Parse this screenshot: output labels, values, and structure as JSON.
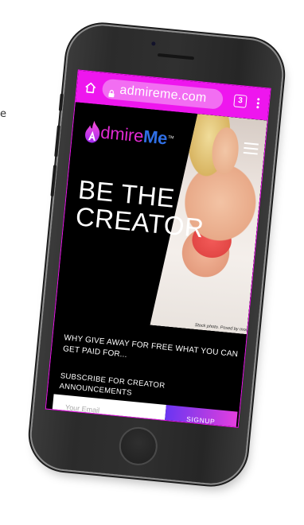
{
  "edge_fragment": "e",
  "browser": {
    "url": "admireme.com",
    "tab_count": "3"
  },
  "brand": {
    "name_part1": "dmire",
    "name_part2": "Me",
    "trademark": "TM",
    "primary_color": "#ee16ee",
    "pink": "#e02ad2",
    "blue": "#2f6fe6"
  },
  "hero": {
    "headline_line1": "BE THE",
    "headline_line2": "CREATOR",
    "photo_caption": "Stock photo. Posed by model."
  },
  "content": {
    "tagline": "WHY GIVE AWAY FOR FREE WHAT YOU CAN GET PAID FOR...",
    "subscribe_label": "SUBSCRIBE FOR CREATOR ANNOUNCEMENTS"
  },
  "form": {
    "email_placeholder": "Your Email",
    "signup_label": "SIGNUP"
  },
  "icons": {
    "home": "home-icon",
    "lock": "lock-icon",
    "menu": "hamburger-menu-icon",
    "overflow": "overflow-menu-icon",
    "flame": "flame-logo-icon"
  }
}
